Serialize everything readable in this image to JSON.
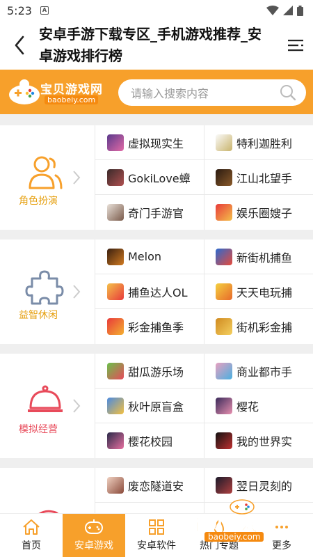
{
  "status_bar": {
    "time": "5:23",
    "notif_glyph": "A"
  },
  "header": {
    "title": "安卓手游下载专区_手机游戏推荐_安卓游戏排行榜",
    "back_icon": "chevron-left-icon",
    "menu_icon": "hamburger-menu-icon"
  },
  "brand": {
    "logo_text": "宝贝游戏网",
    "logo_domain": "baobeiy.com",
    "search_placeholder": "请输入搜索内容",
    "accent_color": "#f7a02b"
  },
  "categories": [
    {
      "label": "角色扮演",
      "icon": "people-icon",
      "games": [
        "虚拟现实生",
        "特利迦胜利",
        "GokiLove蟑",
        "江山北望手",
        "奇门手游官",
        "娱乐圈嫂子"
      ]
    },
    {
      "label": "益智休闲",
      "icon": "puzzle-icon",
      "games": [
        "Melon",
        "新街机捕鱼",
        "捕鱼达人OL",
        "天天电玩捕",
        "彩金捕鱼季",
        "街机彩金捕"
      ]
    },
    {
      "label": "模拟经营",
      "icon": "service-bell-icon",
      "games": [
        "甜瓜游乐场",
        "商业都市手",
        "秋叶原盲盒",
        "樱花",
        "樱花校园",
        "我的世界实"
      ]
    },
    {
      "label": "",
      "icon": "fish-icon",
      "games": [
        "废恋隧道安",
        "翌日灵刻的"
      ]
    }
  ],
  "bottom_nav": [
    {
      "label": "首页",
      "icon": "home-icon"
    },
    {
      "label": "安卓游戏",
      "icon": "gamepad-icon",
      "active": true
    },
    {
      "label": "安卓软件",
      "icon": "apps-grid-icon"
    },
    {
      "label": "热门专题",
      "icon": "fire-icon"
    },
    {
      "label": "更多",
      "icon": "more-icon"
    }
  ],
  "watermark": {
    "text": "宝贝游戏网",
    "domain": "baobeiy.com"
  }
}
